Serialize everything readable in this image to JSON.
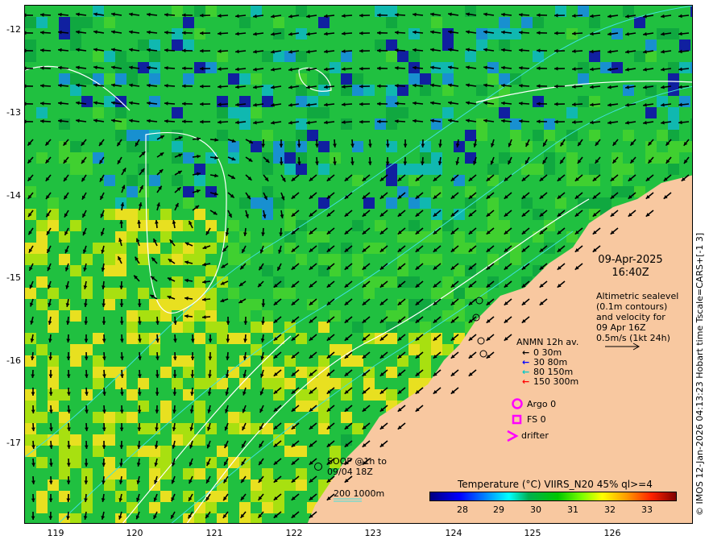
{
  "map": {
    "y_ticks": [
      "-12",
      "-13",
      "-14",
      "-15",
      "-16",
      "-17"
    ],
    "x_ticks": [
      "119",
      "120",
      "121",
      "122",
      "123",
      "124",
      "125",
      "126"
    ],
    "lat_range": [
      -17.95,
      -11.7
    ],
    "lon_range": [
      118.6,
      127.0
    ]
  },
  "info": {
    "date": "09-Apr-2025",
    "time": "16:40Z",
    "altimetry_lines": [
      "Altimetric sealevel",
      "(0.1m contours)",
      "and velocity for",
      "09 Apr 16Z",
      "0.5m/s (1kt 24h)"
    ]
  },
  "anmn": {
    "title": "ANMN 12h av.",
    "rows": [
      {
        "label": "0 30m",
        "color": "#000000"
      },
      {
        "label": "30 80m",
        "color": "#0000ff"
      },
      {
        "label": "80 150m",
        "color": "#00c8c8"
      },
      {
        "label": "150 300m",
        "color": "#ff0000"
      }
    ]
  },
  "legend": {
    "argo": "Argo 0",
    "fs": "FS 0",
    "drifter": "drifter",
    "marker_color": "#ff00ff"
  },
  "soop": {
    "line1": "SOOP @1h to",
    "line2": "09/04 18Z"
  },
  "depth_label": "200  1000m",
  "colorbar": {
    "title": "Temperature (°C) VIIRS_N20 45% ql>=4",
    "ticks": [
      "28",
      "29",
      "30",
      "31",
      "32",
      "33"
    ]
  },
  "copyright": "© IMOS 12-Jan-2026 04:13:23 Hobart time Tscale=CARS+[-1 3]",
  "colors": {
    "land": "#f8c8a0",
    "sea_base": "#20c040",
    "contour": "#ffffff",
    "isobath": "#40e0e0"
  }
}
